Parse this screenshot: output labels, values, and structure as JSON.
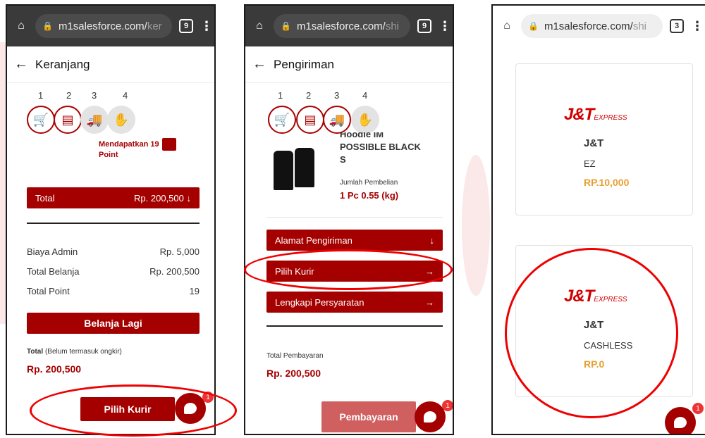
{
  "phone1": {
    "url_main": "m1salesforce.com/",
    "url_dim": "ker",
    "tab_count": "9",
    "title": "Keranjang",
    "step_numbers": [
      "1",
      "2",
      "3",
      "4"
    ],
    "reward_text": "Mendapatkan 19 Point",
    "total_label": "Total",
    "total_value": "Rp. 200,500",
    "rows": [
      {
        "label": "Biaya Admin",
        "value": "Rp. 5,000"
      },
      {
        "label": "Total Belanja",
        "value": "Rp. 200,500"
      },
      {
        "label": "Total Point",
        "value": "19"
      }
    ],
    "continue_button": "Belanja Lagi",
    "total_note_bold": "Total",
    "total_note_rest": "(Belum termasuk ongkir)",
    "grand_total": "Rp. 200,500",
    "courier_button": "Pilih Kurir",
    "chat_badge": "1"
  },
  "phone2": {
    "url_main": "m1salesforce.com/",
    "url_dim": "shi",
    "tab_count": "9",
    "title": "Pengiriman",
    "step_numbers": [
      "1",
      "2",
      "3",
      "4"
    ],
    "product_name_top": "Hoodie IM",
    "product_name_line2": "POSSIBLE BLACK",
    "product_name_line3": "S",
    "qty_label": "Jumlah Pembelian",
    "qty_value": "1 Pc 0.55 (kg)",
    "menu": [
      "Alamat Pengiriman",
      "Pilih Kurir",
      "Lengkapi Persyaratan"
    ],
    "payment_label": "Total Pembayaran",
    "payment_value": "Rp. 200,500",
    "pay_button": "Pembayaran",
    "chat_badge": "1"
  },
  "phone3": {
    "url_main": "m1salesforce.com/",
    "url_dim": "shi",
    "tab_count": "3",
    "options": [
      {
        "logo": "J&T",
        "logo_sub": "EXPRESS",
        "name": "J&T",
        "service": "EZ",
        "price": "RP.10,000"
      },
      {
        "logo": "J&T",
        "logo_sub": "EXPRESS",
        "name": "J&T",
        "service": "CASHLESS",
        "price": "RP.0"
      }
    ],
    "chat_badge": "1"
  }
}
